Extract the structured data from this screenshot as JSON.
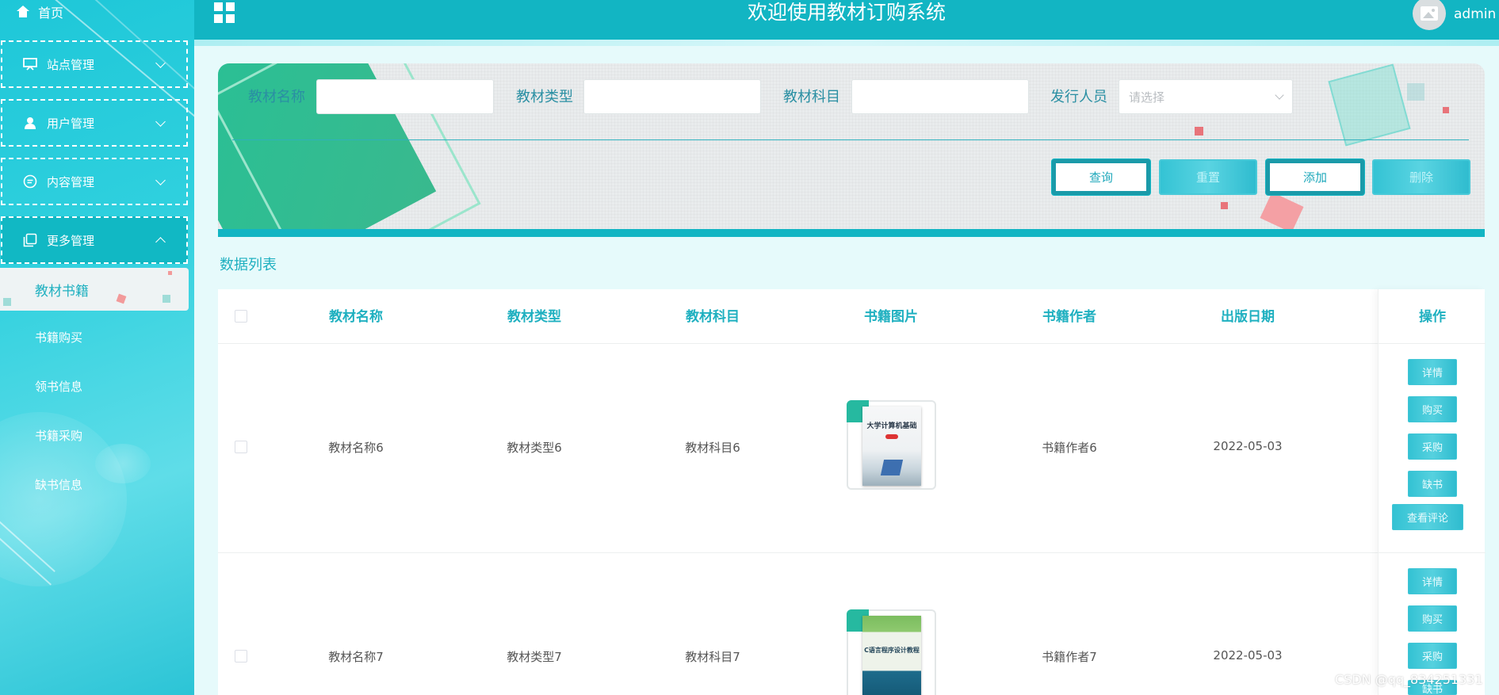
{
  "header": {
    "title": "欢迎使用教材订购系统",
    "username": "admin"
  },
  "sidebar": {
    "home": "首页",
    "groups": [
      {
        "label": "站点管理",
        "icon": "monitor-icon",
        "expanded": false
      },
      {
        "label": "用户管理",
        "icon": "user-icon",
        "expanded": false
      },
      {
        "label": "内容管理",
        "icon": "chat-icon",
        "expanded": false
      },
      {
        "label": "更多管理",
        "icon": "copy-icon",
        "expanded": true
      }
    ],
    "sub_items": [
      "教材书籍",
      "书籍购买",
      "领书信息",
      "书籍采购",
      "缺书信息"
    ],
    "active_sub": "教材书籍"
  },
  "search": {
    "fields": [
      {
        "label": "教材名称",
        "value": ""
      },
      {
        "label": "教材类型",
        "value": ""
      },
      {
        "label": "教材科目",
        "value": ""
      }
    ],
    "publisher_label": "发行人员",
    "publisher_placeholder": "请选择",
    "buttons": [
      "查询",
      "重置",
      "添加",
      "删除"
    ]
  },
  "list": {
    "title": "数据列表",
    "columns": [
      "教材名称",
      "教材类型",
      "教材科目",
      "书籍图片",
      "书籍作者",
      "出版日期",
      "操作"
    ],
    "rows": [
      {
        "name": "教材名称6",
        "type": "教材类型6",
        "subject": "教材科目6",
        "cover_title": "大学计算机基础",
        "author": "书籍作者6",
        "date": "2022-05-03"
      },
      {
        "name": "教材名称7",
        "type": "教材类型7",
        "subject": "教材科目7",
        "cover_title": "C语言程序设计教程",
        "author": "书籍作者7",
        "date": "2022-05-03"
      }
    ],
    "actions": [
      "详情",
      "购买",
      "采购",
      "缺书",
      "查看评论"
    ]
  },
  "watermark": "CSDN @qq_834251331",
  "colors": {
    "accent": "#12b5c3",
    "accent_text": "#1fb0c0",
    "sidebar_bg": "#2fd0de",
    "search_green": "#27c196"
  }
}
